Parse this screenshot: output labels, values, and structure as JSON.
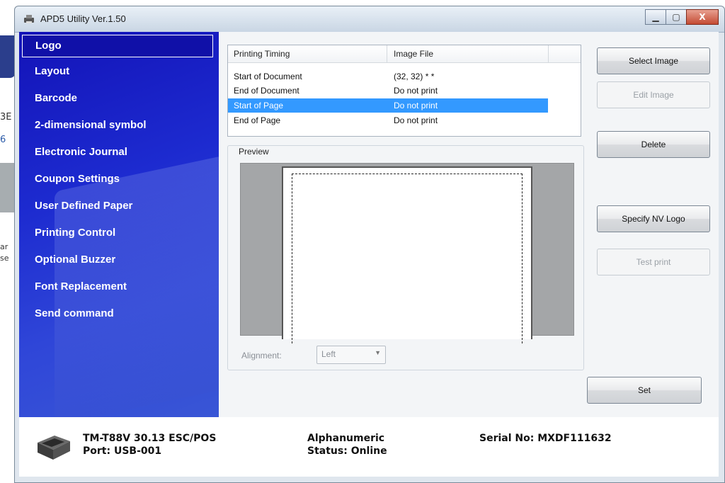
{
  "window": {
    "title": "APD5 Utility Ver.1.50",
    "buttons": {
      "minimize": "▁",
      "maximize": "▢",
      "close": "X"
    }
  },
  "background": {
    "frag1": "3E",
    "frag2": "6",
    "frag3": "ar",
    "frag4": "se"
  },
  "sidebar": {
    "items": [
      {
        "label": "Logo",
        "active": true
      },
      {
        "label": "Layout"
      },
      {
        "label": "Barcode"
      },
      {
        "label": "2-dimensional symbol"
      },
      {
        "label": "Electronic Journal"
      },
      {
        "label": "Coupon Settings"
      },
      {
        "label": "User Defined Paper"
      },
      {
        "label": "Printing Control"
      },
      {
        "label": "Optional Buzzer"
      },
      {
        "label": "Font Replacement"
      },
      {
        "label": "Send command"
      }
    ]
  },
  "table": {
    "headers": [
      "Printing Timing",
      "Image File"
    ],
    "rows": [
      {
        "timing": "Start of Document",
        "file": "(32, 32) *  *"
      },
      {
        "timing": "End of Document",
        "file": "Do not print"
      },
      {
        "timing": "Start of Page",
        "file": "Do not print",
        "selected": true
      },
      {
        "timing": "End of Page",
        "file": "Do not print"
      }
    ]
  },
  "preview": {
    "label": "Preview",
    "alignment_label": "Alignment:",
    "alignment_value": "Left"
  },
  "buttons": {
    "select_image": "Select Image",
    "edit_image": "Edit Image",
    "delete": "Delete",
    "specify_nv_logo": "Specify NV Logo",
    "test_print": "Test print",
    "set": "Set"
  },
  "status": {
    "model": "TM-T88V 30.13 ESC/POS",
    "port": "Port: USB-001",
    "mode": "Alphanumeric",
    "state": "Status: Online",
    "serial": "Serial No: MXDF111632"
  },
  "colors": {
    "sidebar": "#1d2bd0",
    "selection": "#3399ff"
  }
}
